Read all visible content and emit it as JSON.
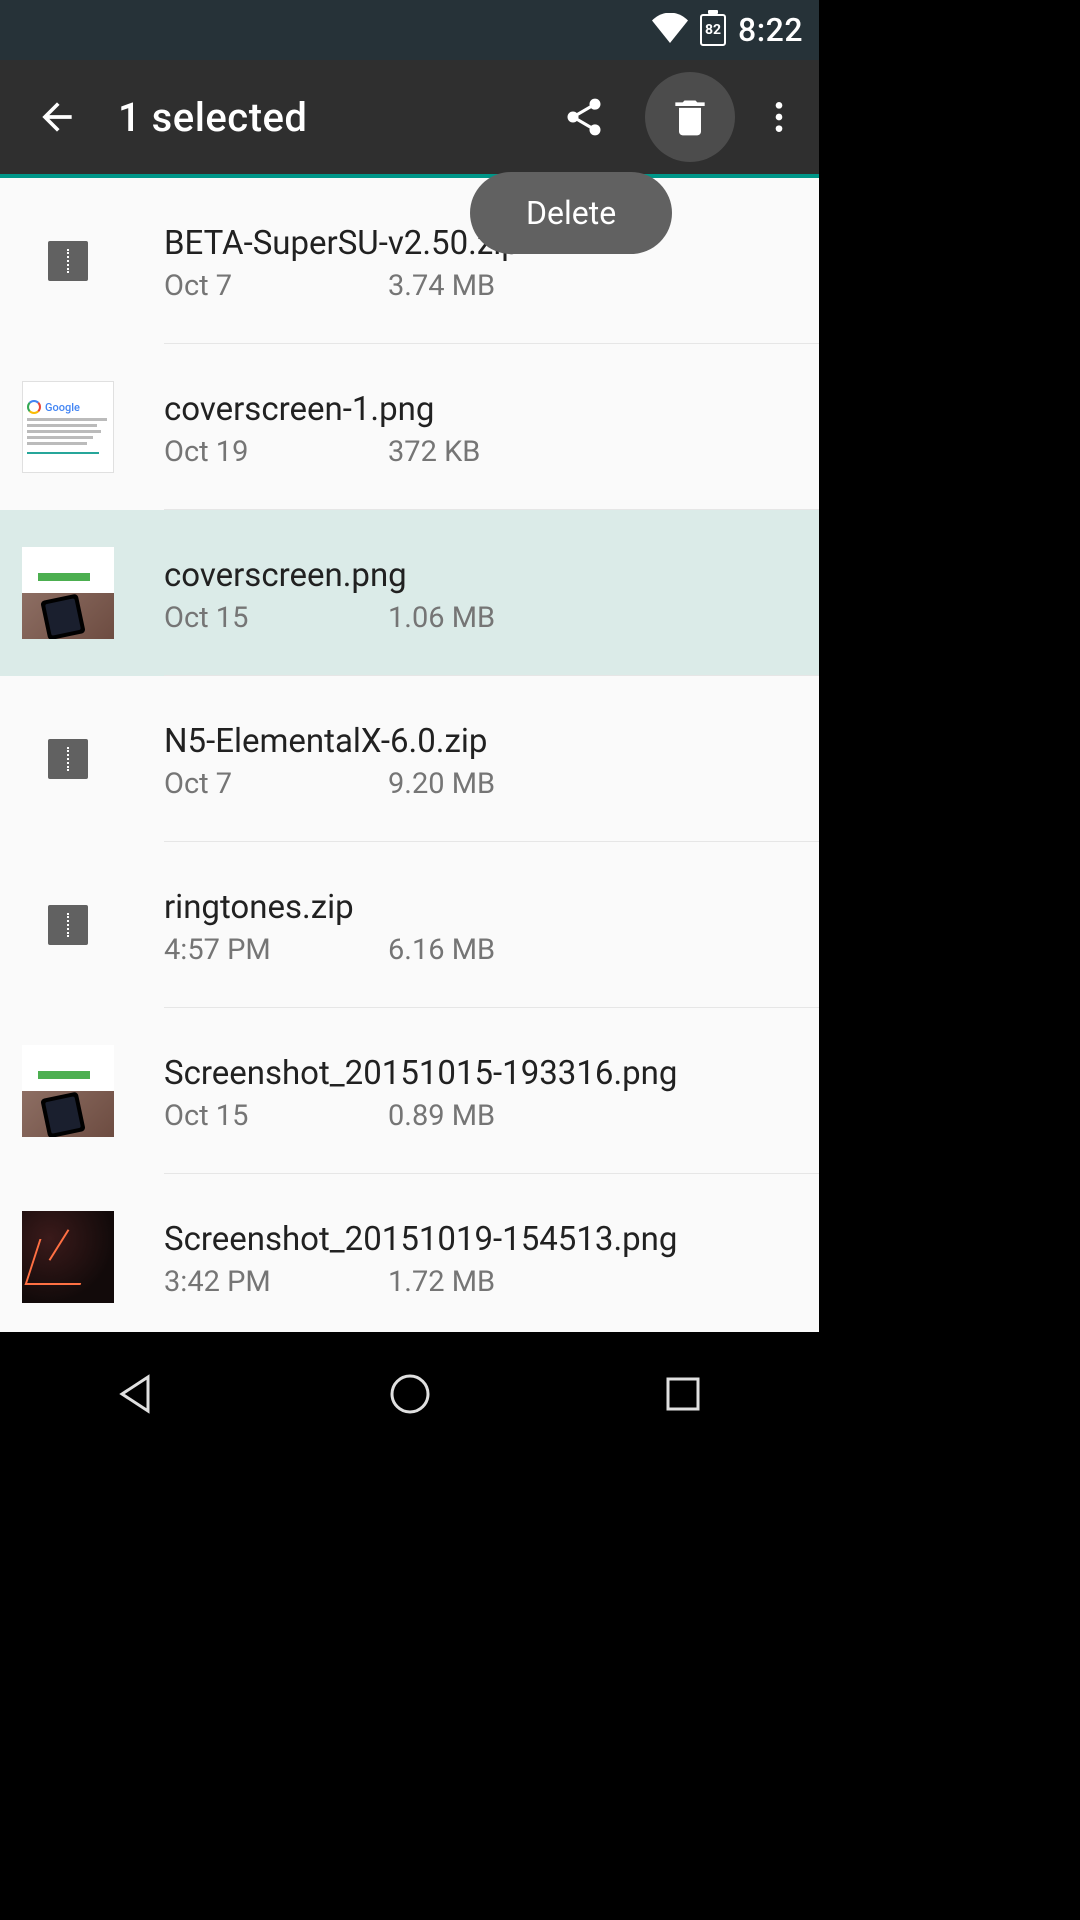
{
  "statusbar": {
    "battery_pct": "82",
    "clock": "8:22"
  },
  "actionbar": {
    "title": "1 selected"
  },
  "tooltip": {
    "delete": "Delete"
  },
  "files": [
    {
      "name": "BETA-SuperSU-v2.50.zip",
      "date": "Oct 7",
      "size": "3.74 MB",
      "kind": "archive",
      "selected": false
    },
    {
      "name": "coverscreen-1.png",
      "date": "Oct 19",
      "size": "372 KB",
      "kind": "g1",
      "selected": false
    },
    {
      "name": "coverscreen.png",
      "date": "Oct 15",
      "size": "1.06 MB",
      "kind": "shot",
      "selected": true
    },
    {
      "name": "N5-ElementalX-6.0.zip",
      "date": "Oct 7",
      "size": "9.20 MB",
      "kind": "archive",
      "selected": false
    },
    {
      "name": "ringtones.zip",
      "date": "4:57 PM",
      "size": "6.16 MB",
      "kind": "archive",
      "selected": false
    },
    {
      "name": "Screenshot_20151015-193316.png",
      "date": "Oct 15",
      "size": "0.89 MB",
      "kind": "shot",
      "selected": false
    },
    {
      "name": "Screenshot_20151019-154513.png",
      "date": "3:42 PM",
      "size": "1.72 MB",
      "kind": "stars",
      "selected": false
    }
  ]
}
